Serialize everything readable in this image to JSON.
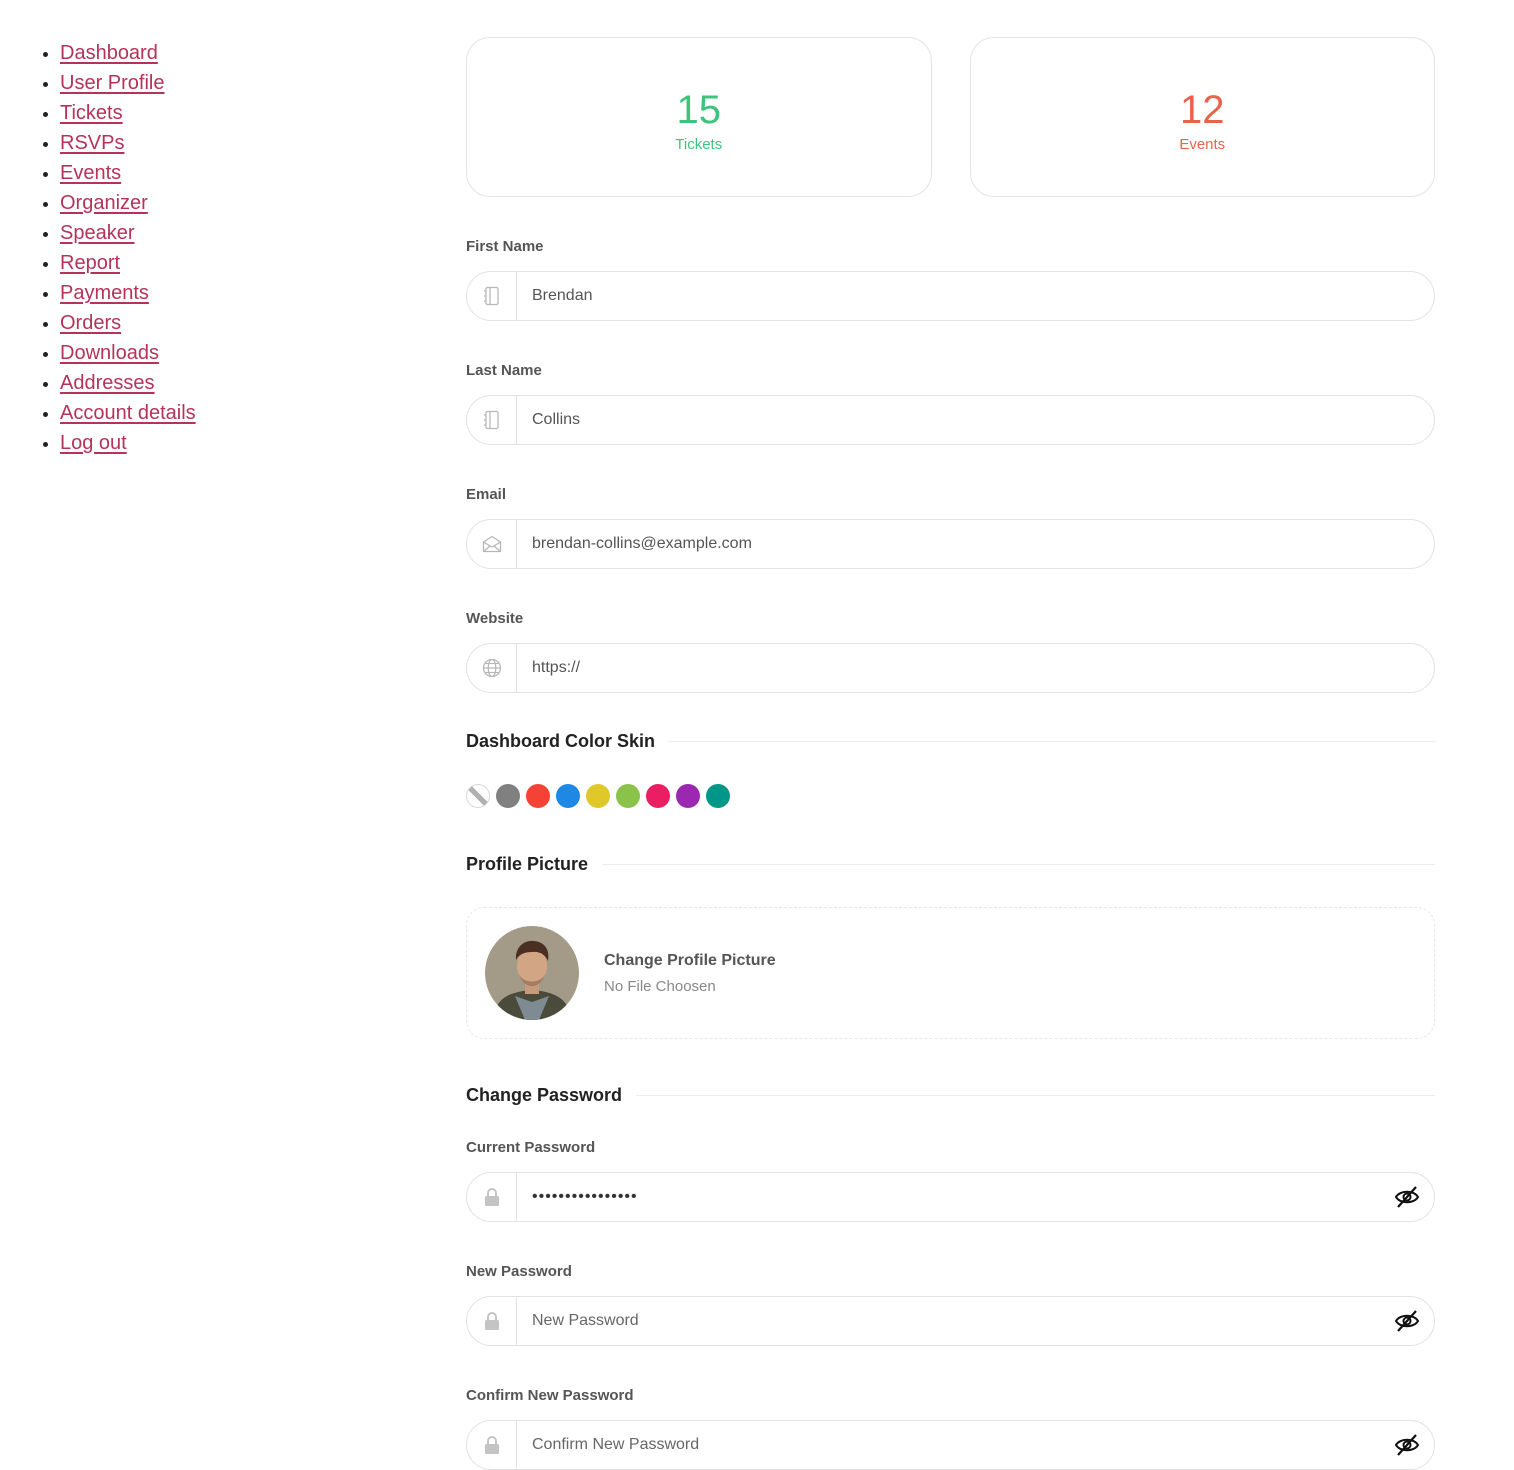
{
  "nav": [
    "Dashboard",
    "User Profile",
    "Tickets",
    "RSVPs",
    "Events",
    "Organizer",
    "Speaker",
    "Report",
    "Payments",
    "Orders",
    "Downloads",
    "Addresses",
    "Account details",
    "Log out"
  ],
  "stats": {
    "tickets": {
      "value": "15",
      "label": "Tickets",
      "color": "#3cc47c"
    },
    "events": {
      "value": "12",
      "label": "Events",
      "color": "#e8634a"
    }
  },
  "fields": {
    "first_name": {
      "label": "First Name",
      "value": "Brendan",
      "icon": "notebook-icon"
    },
    "last_name": {
      "label": "Last Name",
      "value": "Collins",
      "icon": "notebook-icon"
    },
    "email": {
      "label": "Email",
      "value": "brendan-collins@example.com",
      "icon": "envelope-icon"
    },
    "website": {
      "label": "Website",
      "value": "https://",
      "icon": "globe-icon"
    }
  },
  "color_skin": {
    "title": "Dashboard Color Skin",
    "swatches": [
      "none",
      "#808080",
      "#f44336",
      "#1e88e5",
      "#e0c72a",
      "#8bc34a",
      "#e91e63",
      "#9c27b0",
      "#009688"
    ]
  },
  "profile_picture": {
    "title": "Profile Picture",
    "change_label": "Change Profile Picture",
    "file_status": "No File Choosen"
  },
  "password": {
    "title": "Change Password",
    "current": {
      "label": "Current Password",
      "value": "••••••••••••••••"
    },
    "new": {
      "label": "New Password",
      "placeholder": "New Password"
    },
    "confirm": {
      "label": "Confirm New Password",
      "placeholder": "Confirm New Password"
    }
  }
}
